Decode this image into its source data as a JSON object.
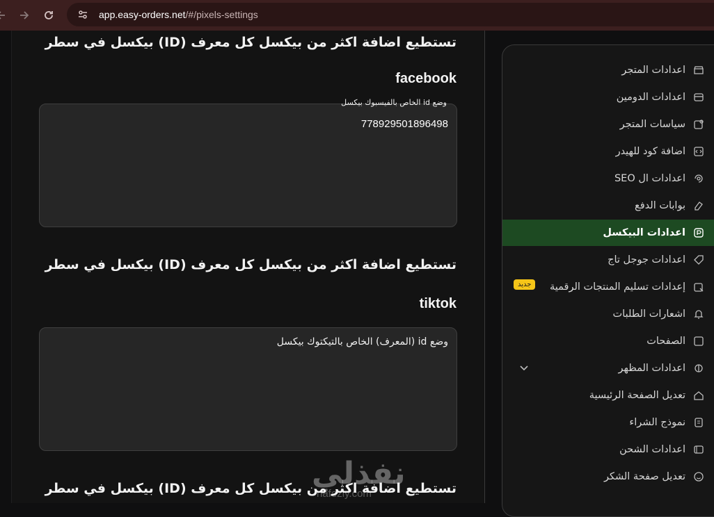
{
  "browser": {
    "url_host": "app.easy-orders.net",
    "url_path": "/#/pixels-settings"
  },
  "main": {
    "hint_text": "تستطيع اضافة اكثر من بيكسل كل معرف (ID) بيكسل في سطر",
    "facebook": {
      "name": "facebook",
      "label": "وضع id الخاص بالفيسبوك بيكسل",
      "value": "778929501896498"
    },
    "tiktok": {
      "name": "tiktok",
      "placeholder": "وضع id (المعرف) الخاص بالتيكتوك بيكسل"
    }
  },
  "sidebar": {
    "items": [
      {
        "label": "اعدادات المتجر",
        "icon": "store-icon"
      },
      {
        "label": "اعدادات الدومين",
        "icon": "domain-icon"
      },
      {
        "label": "سياسات المتجر",
        "icon": "policy-icon"
      },
      {
        "label": "اضافة كود للهيدر",
        "icon": "code-icon"
      },
      {
        "label": "اعدادات ال SEO",
        "icon": "seo-icon"
      },
      {
        "label": "بوابات الدفع",
        "icon": "payment-icon"
      },
      {
        "label": "اعدادات البيكسل",
        "icon": "pixel-icon"
      },
      {
        "label": "اعدادات جوجل تاج",
        "icon": "tag-icon"
      },
      {
        "label": "إعدادات تسليم المنتجات الرقمية",
        "icon": "digital-delivery-icon",
        "badge": "جديد"
      },
      {
        "label": "اشعارات الطلبات",
        "icon": "bell-icon"
      },
      {
        "label": "الصفحات",
        "icon": "pages-icon"
      },
      {
        "label": "اعدادات المظهر",
        "icon": "appearance-icon"
      },
      {
        "label": "تعديل الصفحة الرئيسية",
        "icon": "home-icon"
      },
      {
        "label": "نموذج الشراء",
        "icon": "form-icon"
      },
      {
        "label": "اعدادات الشحن",
        "icon": "shipping-icon"
      },
      {
        "label": "تعديل صفحة الشكر",
        "icon": "smile-icon"
      }
    ],
    "colors": {
      "active_bg": "#1d4a22",
      "badge_bg": "#f5c518"
    }
  },
  "watermark": {
    "text": "نفذلي",
    "sub": "nafezly.com"
  }
}
